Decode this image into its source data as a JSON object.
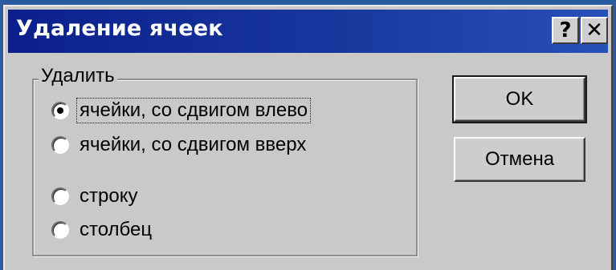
{
  "dialog": {
    "title": "Удаление ячеек",
    "help_button": "?",
    "close_button": "✕"
  },
  "group": {
    "legend": "Удалить",
    "options": [
      {
        "label": "ячейки, со сдвигом влево",
        "selected": true,
        "focused": true
      },
      {
        "label": "ячейки, со сдвигом вверх",
        "selected": false
      },
      {
        "label": "строку",
        "selected": false
      },
      {
        "label": "столбец",
        "selected": false
      }
    ]
  },
  "buttons": {
    "ok": "OK",
    "cancel": "Отмена"
  }
}
